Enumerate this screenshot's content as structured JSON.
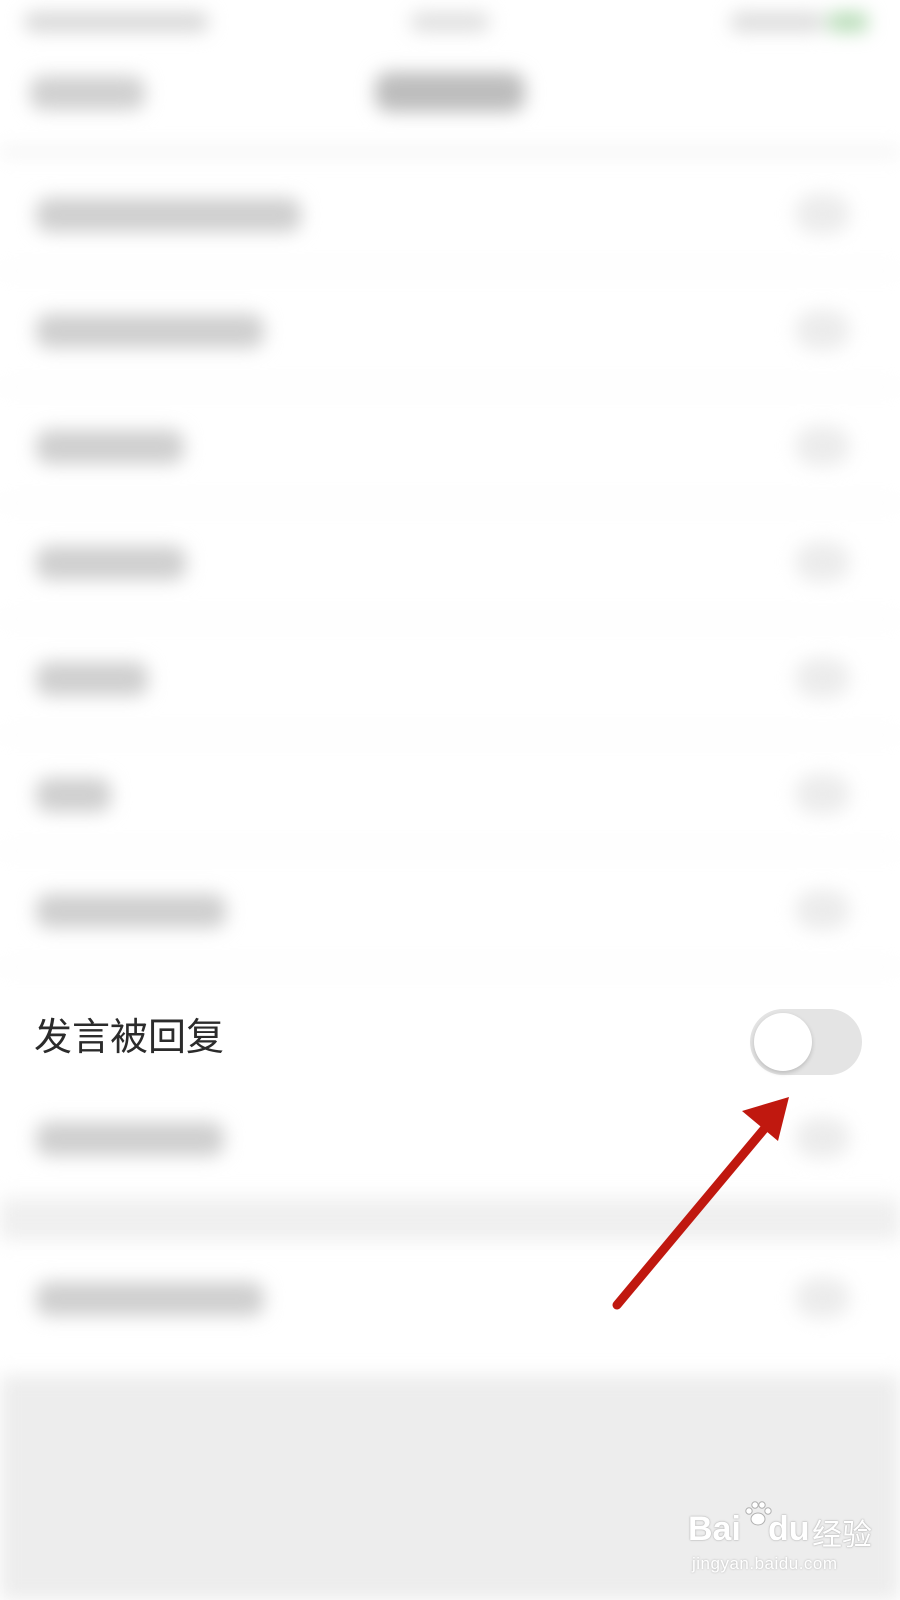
{
  "settings_row": {
    "label": "发言被回复",
    "toggle_on": false
  },
  "watermark": {
    "brand_left": "Bai",
    "brand_right": "du",
    "brand_cn": "经验",
    "url": "jingyan.baidu.com"
  },
  "colors": {
    "label_text": "#2b2b2b",
    "toggle_track_off": "#e4e4e4",
    "toggle_knob": "#ffffff",
    "annotation_arrow": "#c0180f"
  },
  "icons": {
    "watermark_logo": "baidu-paw-icon",
    "annotation": "red-arrow-icon"
  }
}
